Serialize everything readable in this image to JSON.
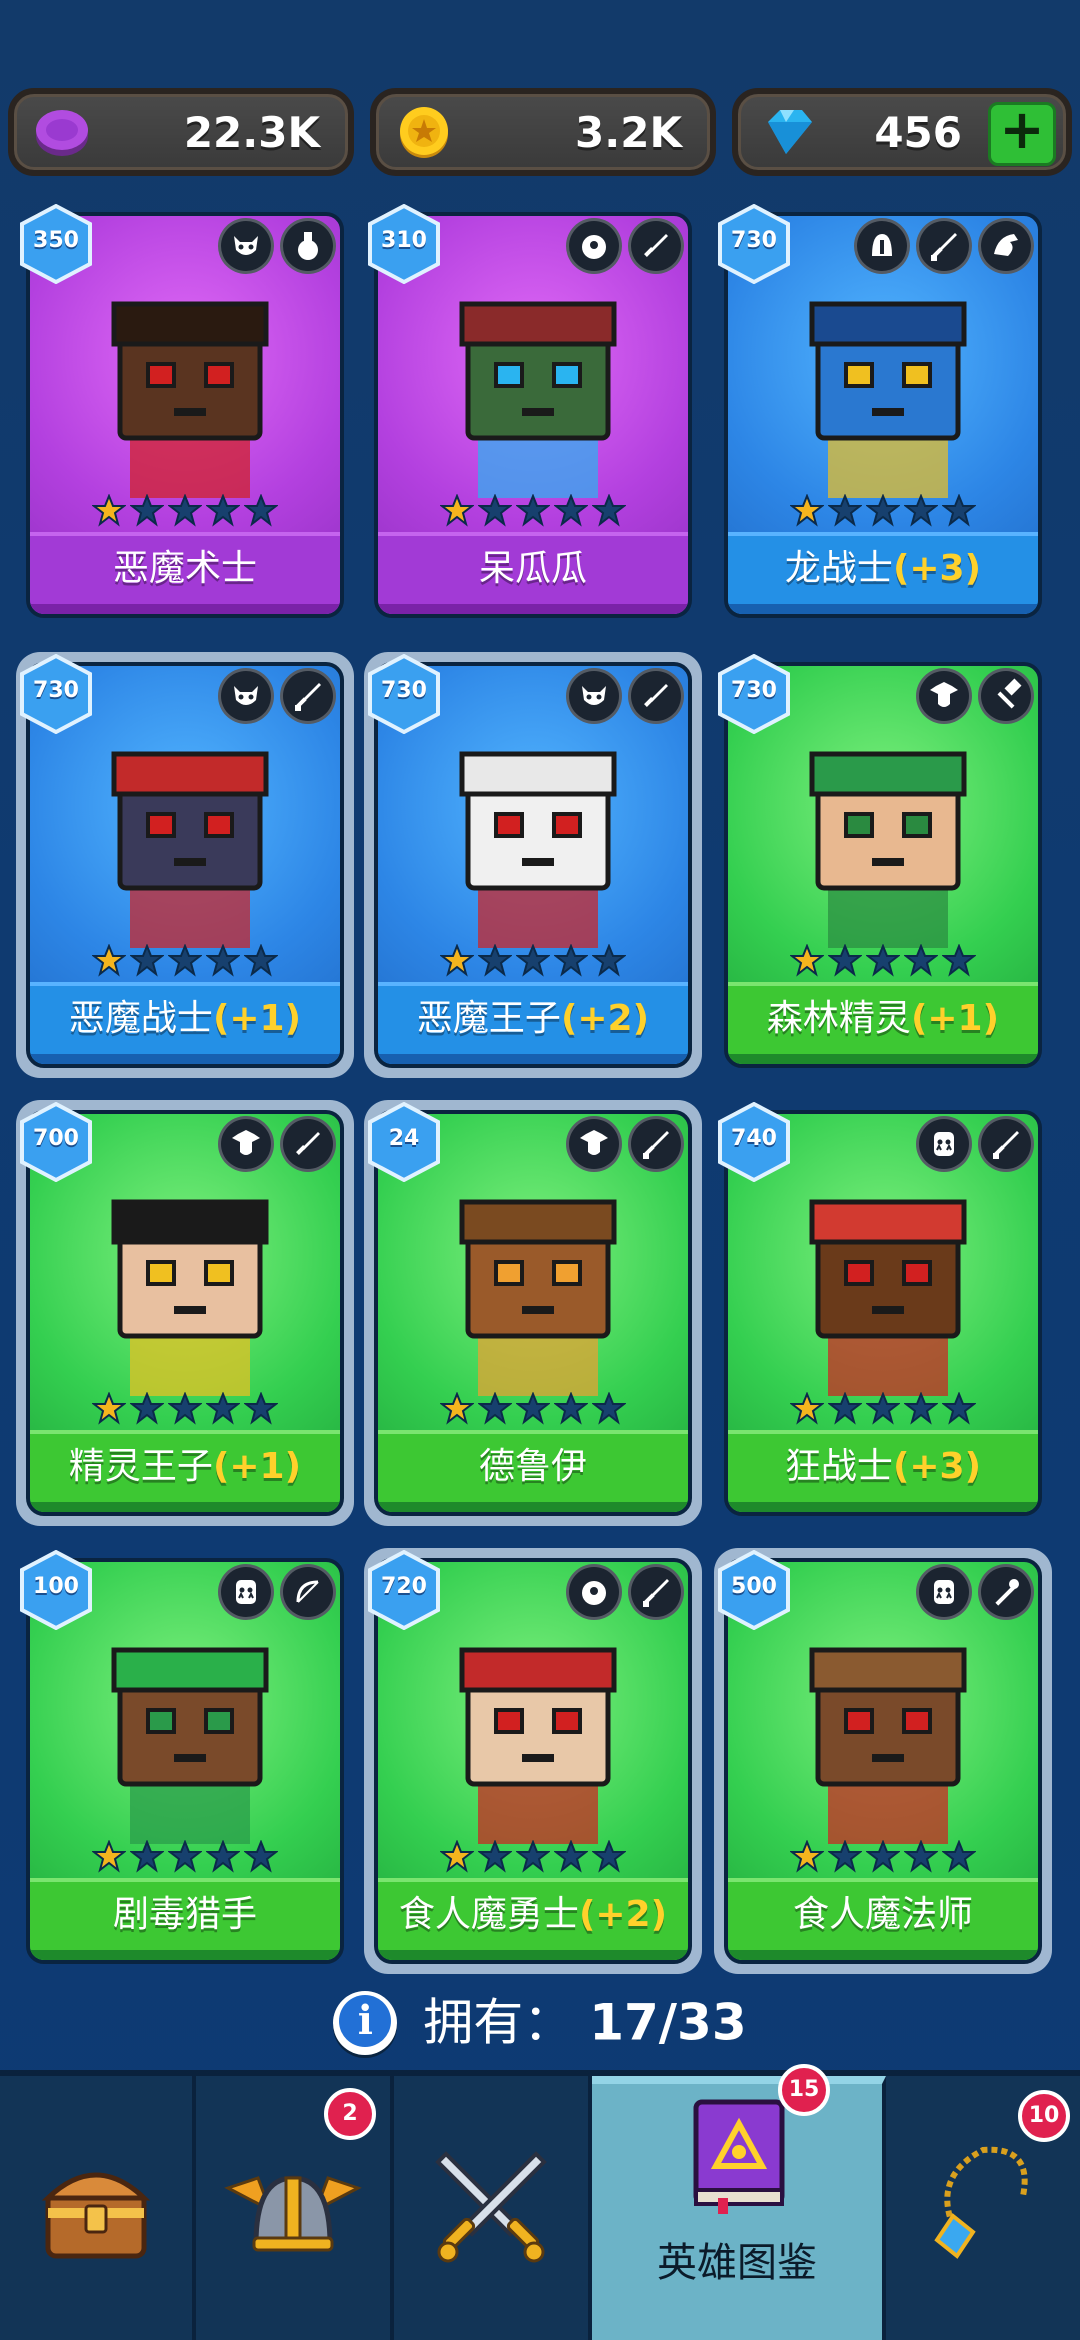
{
  "currency": {
    "gems_purple": "22.3K",
    "coins": "3.2K",
    "diamonds": "456",
    "add_label": "+"
  },
  "heroes": [
    {
      "name": "恶魔术士",
      "bonus": "",
      "level": "350",
      "rarity": "purple",
      "stars": 1,
      "traits": [
        "demon-face-icon",
        "skull-flask-icon"
      ]
    },
    {
      "name": "呆瓜瓜",
      "bonus": "",
      "level": "310",
      "rarity": "purple",
      "stars": 1,
      "traits": [
        "one-eye-face-icon",
        "dagger-icon"
      ]
    },
    {
      "name": "龙战士",
      "bonus": "(+3)",
      "level": "730",
      "rarity": "blue",
      "stars": 1,
      "traits": [
        "helmet-icon",
        "sword-icon",
        "dragon-icon"
      ]
    },
    {
      "name": "恶魔战士",
      "bonus": "(+1)",
      "level": "730",
      "rarity": "blue",
      "stars": 1,
      "traits": [
        "demon-face-icon",
        "sword-icon"
      ]
    },
    {
      "name": "恶魔王子",
      "bonus": "(+2)",
      "level": "730",
      "rarity": "blue",
      "stars": 1,
      "traits": [
        "demon-face-icon",
        "dagger-icon"
      ]
    },
    {
      "name": "森林精灵",
      "bonus": "(+1)",
      "level": "730",
      "rarity": "green",
      "stars": 1,
      "traits": [
        "elf-face-icon",
        "hammer-icon"
      ]
    },
    {
      "name": "精灵王子",
      "bonus": "(+1)",
      "level": "700",
      "rarity": "green",
      "stars": 1,
      "traits": [
        "elf-face-icon",
        "dagger-icon"
      ]
    },
    {
      "name": "德鲁伊",
      "bonus": "",
      "level": "24",
      "rarity": "green",
      "stars": 1,
      "traits": [
        "elf-face-icon",
        "sword-icon"
      ]
    },
    {
      "name": "狂战士",
      "bonus": "(+3)",
      "level": "740",
      "rarity": "green",
      "stars": 1,
      "traits": [
        "orc-face-icon",
        "sword-icon"
      ]
    },
    {
      "name": "剧毒猎手",
      "bonus": "",
      "level": "100",
      "rarity": "green",
      "stars": 1,
      "traits": [
        "orc-face-icon",
        "bow-icon"
      ]
    },
    {
      "name": "食人魔勇士",
      "bonus": "(+2)",
      "level": "720",
      "rarity": "green",
      "stars": 1,
      "traits": [
        "one-eye-face-icon",
        "sword-icon"
      ]
    },
    {
      "name": "食人魔法师",
      "bonus": "",
      "level": "500",
      "rarity": "green",
      "stars": 1,
      "traits": [
        "orc-face-icon",
        "staff-icon"
      ]
    }
  ],
  "owned": {
    "label": "拥有：",
    "count": "17/33"
  },
  "nav": {
    "tabs": [
      {
        "id": "chest",
        "icon": "treasure-chest-icon",
        "badge": ""
      },
      {
        "id": "heroes",
        "icon": "winged-helmet-icon",
        "badge": "2"
      },
      {
        "id": "battle",
        "icon": "crossed-swords-icon",
        "badge": ""
      },
      {
        "id": "codex",
        "icon": "spellbook-icon",
        "badge": "15",
        "label": "英雄图鉴",
        "active": true
      },
      {
        "id": "amulet",
        "icon": "amulet-icon",
        "badge": "10"
      }
    ]
  },
  "colors": {
    "star_gold": "#f5b51e",
    "star_empty": "#17406e",
    "bonus_yellow": "#ffd12b"
  }
}
